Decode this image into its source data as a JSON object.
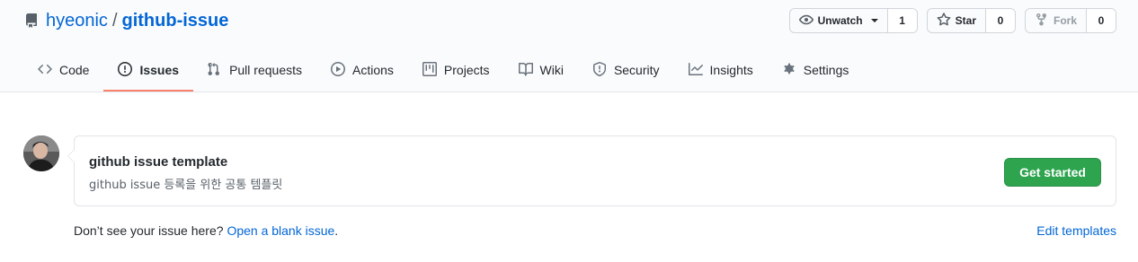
{
  "repo": {
    "owner": "hyeonic",
    "separator": "/",
    "name": "github-issue",
    "icon": "repo-icon"
  },
  "actions": {
    "watch": {
      "label": "Unwatch",
      "count": "1",
      "icon": "eye-icon"
    },
    "star": {
      "label": "Star",
      "count": "0",
      "icon": "star-icon"
    },
    "fork": {
      "label": "Fork",
      "count": "0",
      "icon": "fork-icon"
    }
  },
  "nav": {
    "selected": "Issues",
    "tabs": [
      {
        "label": "Code",
        "icon": "code-icon"
      },
      {
        "label": "Issues",
        "icon": "issue-opened-icon"
      },
      {
        "label": "Pull requests",
        "icon": "git-pull-request-icon"
      },
      {
        "label": "Actions",
        "icon": "play-icon"
      },
      {
        "label": "Projects",
        "icon": "project-icon"
      },
      {
        "label": "Wiki",
        "icon": "book-icon"
      },
      {
        "label": "Security",
        "icon": "shield-icon"
      },
      {
        "label": "Insights",
        "icon": "graph-icon"
      },
      {
        "label": "Settings",
        "icon": "gear-icon"
      }
    ]
  },
  "template": {
    "name": "github issue template",
    "description": "github issue 등록을 위한 공통 템플릿",
    "button": "Get started"
  },
  "footer": {
    "prompt": "Don’t see your issue here? ",
    "blank_issue_link": "Open a blank issue",
    "period": ".",
    "edit_templates": "Edit templates"
  },
  "colors": {
    "link": "#0366d6",
    "primary_button": "#2ea44f",
    "selected_tab_underline": "#f9826c",
    "header_bg": "#fafbfc"
  }
}
